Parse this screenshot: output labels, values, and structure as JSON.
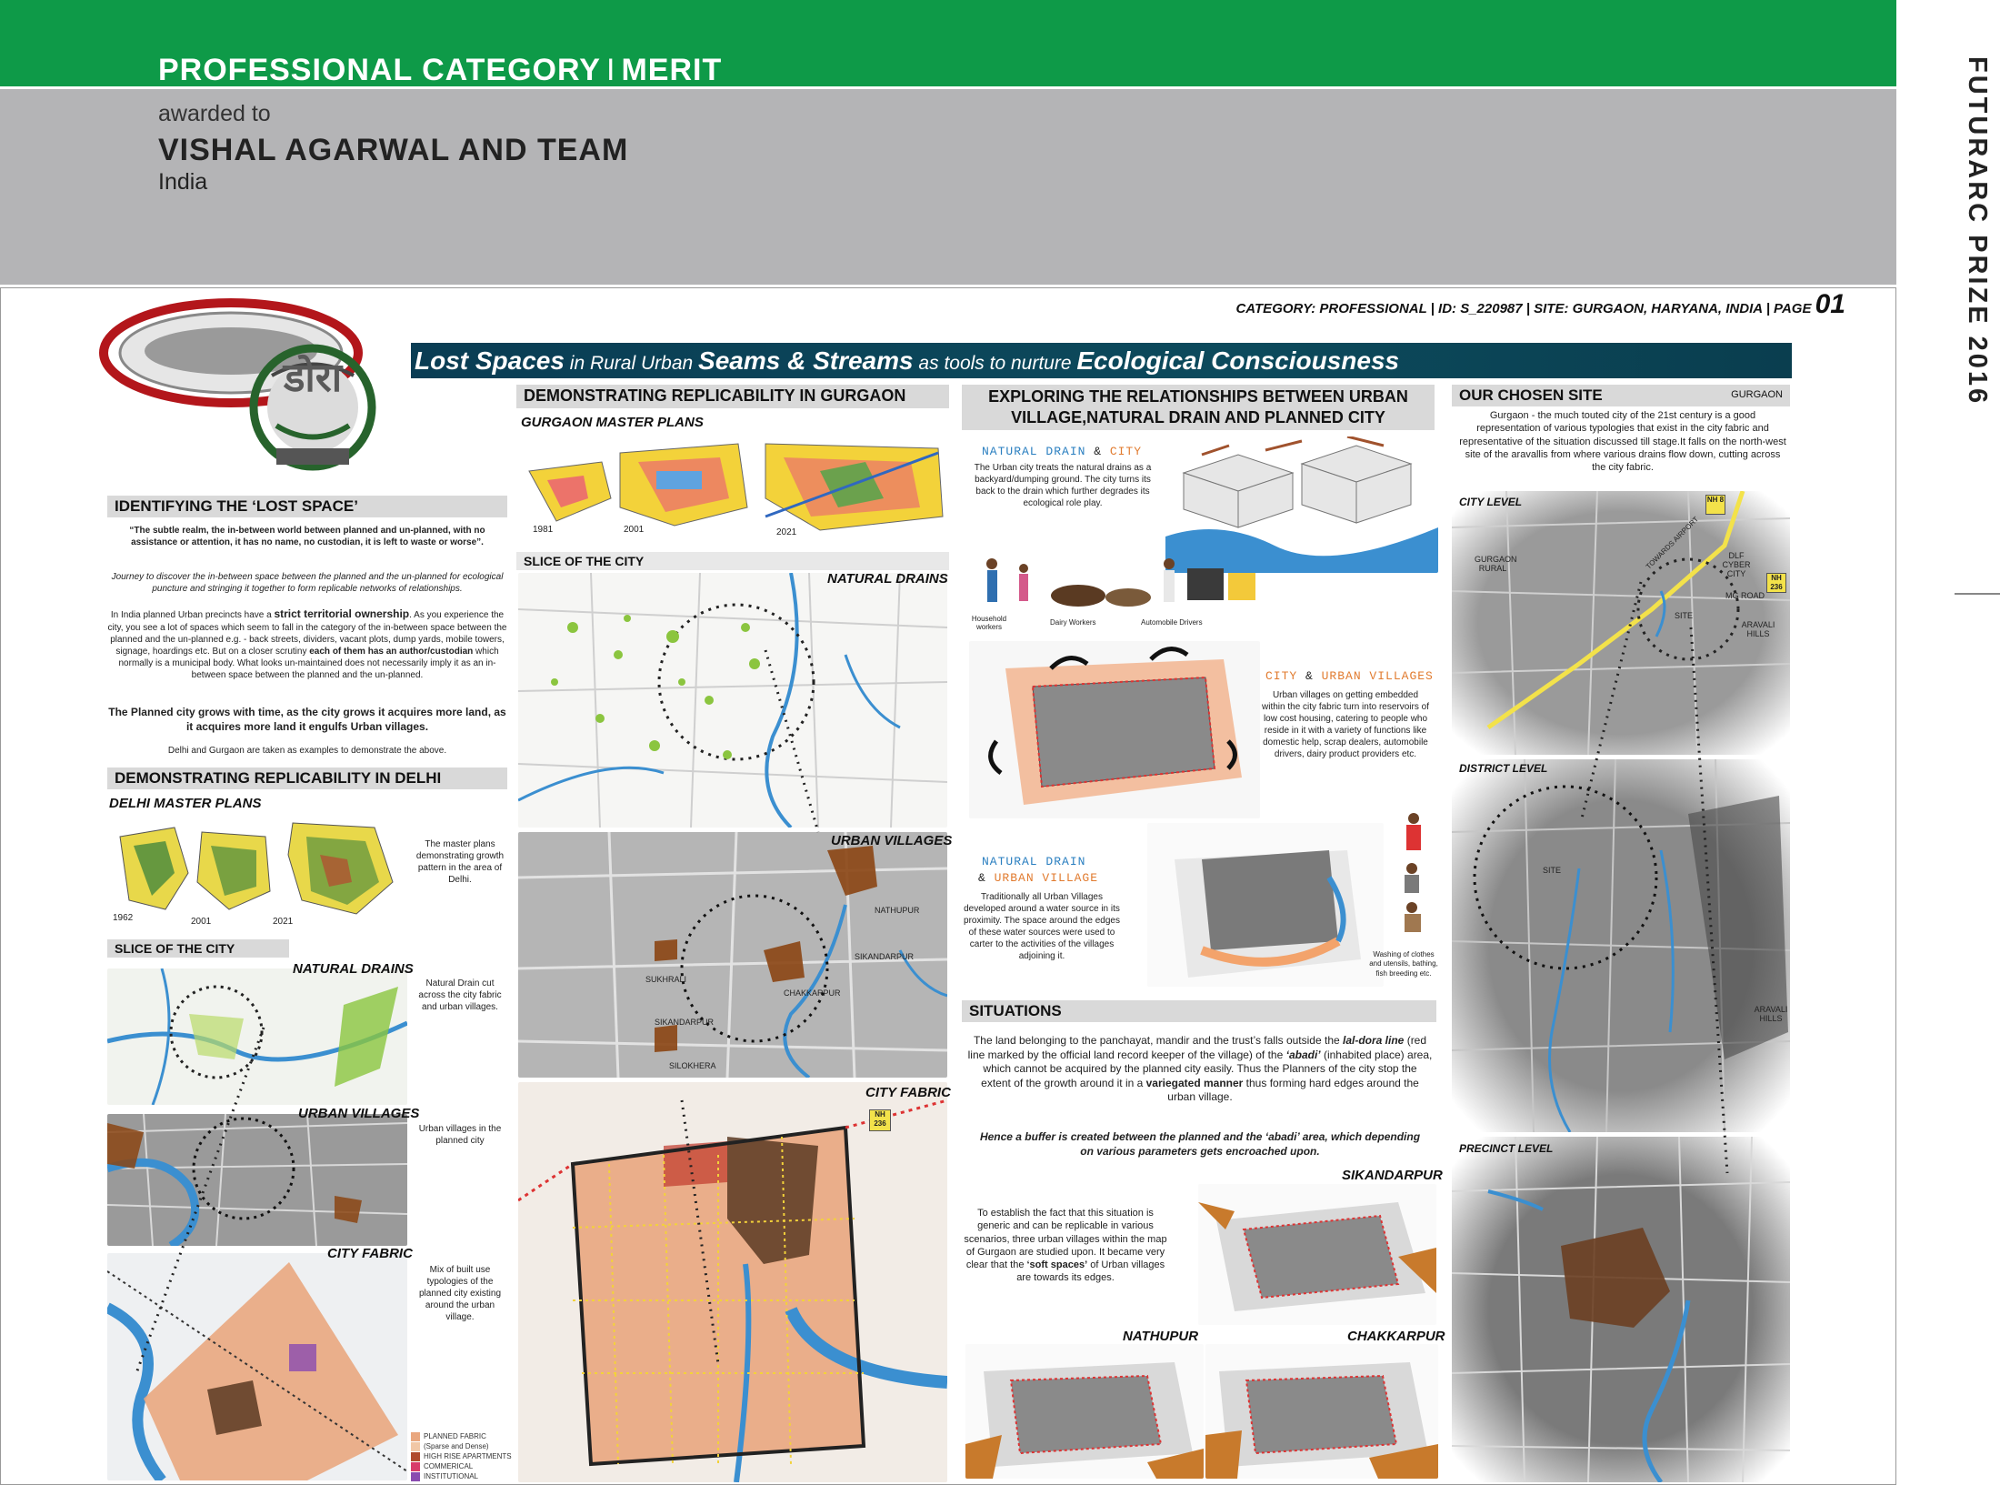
{
  "header": {
    "category": "PROFESSIONAL CATEGORY",
    "separator": "I",
    "award": "MERIT",
    "awarded_label": "awarded to",
    "awardee": "VISHAL AGARWAL AND TEAM",
    "country": "India",
    "side_title": "FUTURARC PRIZE 2016"
  },
  "board": {
    "page_header": "CATEGORY: PROFESSIONAL | ID: S_220987 | SITE: GURGAON, HARYANA, INDIA | PAGE",
    "page_number": "01",
    "logo_text": "डोरा",
    "banner": {
      "p1": "Lost Spaces",
      "p2": " in Rural Urban ",
      "p3": "Seams & Streams",
      "p4": " as tools to nurture ",
      "p5": "Ecological Consciousness"
    }
  },
  "col1": {
    "identifying_head": "IDENTIFYING THE ‘LOST SPACE’",
    "quote": "“The subtle realm, the in-between world between planned and un-planned, with no assistance or attention, it has no name, no custodian, it is left to waste or worse”.",
    "journey": "Journey to discover the in-between space between the planned and the un-planned for ecological puncture and stringing it together to form replicable networks of relationships.",
    "territorial_a": "In India planned Urban precincts have a ",
    "territorial_b": "strict territorial ownership",
    "territorial_c": ". As you experience the city, you see a lot of spaces which seem to fall in the category of the in-between space between the planned and the un-planned e.g. - back streets, dividers, vacant plots, dump yards, mobile towers, signage, hoardings etc. But on a closer scrutiny ",
    "territorial_d": "each of them has an author/custodian",
    "territorial_e": " which normally is a municipal body. What looks un-maintained does not necessarily imply it as an in-between space between the planned and the un-planned.",
    "planned_city": "The Planned city grows with time, as the city grows it acquires more land, as it acquires more land it engulfs Urban villages.",
    "examples": "Delhi and Gurgaon are taken as examples to demonstrate the above.",
    "delhi_head": "DEMONSTRATING REPLICABILITY IN DELHI",
    "delhi_master": "DELHI MASTER PLANS",
    "years": [
      "1962",
      "2001",
      "2021"
    ],
    "master_caption": "The master plans demonstrating growth pattern in the area of Delhi.",
    "slice_head": "SLICE OF THE CITY",
    "natural_drains": "NATURAL DRAINS",
    "drains_caption": "Natural Drain cut across the city fabric and urban villages.",
    "urban_villages": "URBAN VILLAGES",
    "villages_caption": "Urban villages in the planned city",
    "city_fabric": "CITY FABRIC",
    "fabric_caption": "Mix of built use typologies of the planned city existing around the urban village.",
    "legend": [
      "PLANNED FABRIC",
      "(Sparse and Dense)",
      "HIGH RISE APARTMENTS",
      "COMMERICAL",
      "INSTITUTIONAL"
    ]
  },
  "col2": {
    "gurgaon_head": "DEMONSTRATING REPLICABILITY IN GURGAON",
    "gurgaon_master": "GURGAON MASTER PLANS",
    "years": [
      "1981",
      "2001",
      "2021"
    ],
    "slice_head": "SLICE OF THE CITY",
    "natural_drains": "NATURAL DRAINS",
    "urban_villages": "URBAN VILLAGES",
    "city_fabric": "CITY FABRIC",
    "map_labels": [
      "NATHUPUR",
      "SIKANDARPUR",
      "SUKHRALI",
      "CHAKKARPUR",
      "SIKANDARPUR",
      "SILOKHERA"
    ],
    "nh_badge": "NH 236"
  },
  "col3": {
    "exploring_head": "EXPLORING THE RELATIONSHIPS BETWEEN URBAN VILLAGE,NATURAL DRAIN AND PLANNED CITY",
    "nd_city_a": "NATURAL DRAIN",
    "nd_city_amp": " & ",
    "nd_city_b": "CITY",
    "nd_city_text": "The Urban city treats the natural drains as a backyard/dumping ground. The city turns its back to the drain which further degrades its ecological role play.",
    "people_labels": [
      "Household workers",
      "Dairy Workers",
      "Automobile Drivers"
    ],
    "city_uv_a": "CITY",
    "city_uv_amp": " & ",
    "city_uv_b": "URBAN VILLAGES",
    "city_uv_text": "Urban villages on getting embedded within the city fabric turn into reservoirs of low cost housing, catering to people who reside in it with a variety of functions like domestic help, scrap dealers, automobile drivers, dairy product providers etc.",
    "nd_uv_a": "NATURAL DRAIN",
    "nd_uv_amp": "& ",
    "nd_uv_b": "URBAN VILLAGE",
    "nd_uv_text": "Traditionally all Urban Villages developed around a water source in its proximity. The space around the edges of these water sources were used to carter to the activities of the villages adjoining it.",
    "washing_caption": "Washing of clothes and utensils, bathing, fish breeding etc.",
    "situations_head": "SITUATIONS",
    "situations_a": "The land belonging to the panchayat, mandir and the trust’s falls outside the ",
    "situations_b": "lal-dora line",
    "situations_c": " (red line marked by the official land record keeper of the village) of the ",
    "situations_d": "‘abadi’",
    "situations_e": " (inhabited place) area, which cannot be acquired by the planned city easily. Thus the Planners of the city stop the extent of the growth around it in a ",
    "situations_f": "variegated manner",
    "situations_g": " thus forming hard edges around the urban village.",
    "buffer": "Hence a buffer is created between the planned and the ‘abadi’ area, which depending on various parameters gets encroached upon.",
    "sikandarpur": "SIKANDARPUR",
    "establish_a": "To establish the fact that this situation is generic and can be replicable in various scenarios, three urban villages within the map of Gurgaon are studied upon. It became very clear that the ",
    "establish_b": "‘soft spaces’",
    "establish_c": " of Urban villages are towards its edges.",
    "nathupur": "NATHUPUR",
    "chakkarpur": "CHAKKARPUR"
  },
  "col4": {
    "site_head": "OUR CHOSEN SITE",
    "site_tag": "GURGAON",
    "site_text": "Gurgaon - the much touted city of the 21st century is a good representation of various typologies that exist in the city fabric and representative of the situation discussed till stage.It falls on the north-west site of the aravallis from where various drains flow down, cutting across the city fabric.",
    "city_level": "CITY LEVEL",
    "district_level": "DISTRICT LEVEL",
    "precinct_level": "PRECINCT LEVEL",
    "city_map_labels": [
      "GURGAON RURAL",
      "DLF CYBER CITY",
      "MG ROAD",
      "ARAVALI HILLS",
      "SITE",
      "TOWARDS AIRPORT"
    ],
    "district_map_labels": [
      "SITE",
      "ARAVALI HILLS"
    ],
    "nh_8": "NH 8",
    "nh_236": "NH 236"
  }
}
